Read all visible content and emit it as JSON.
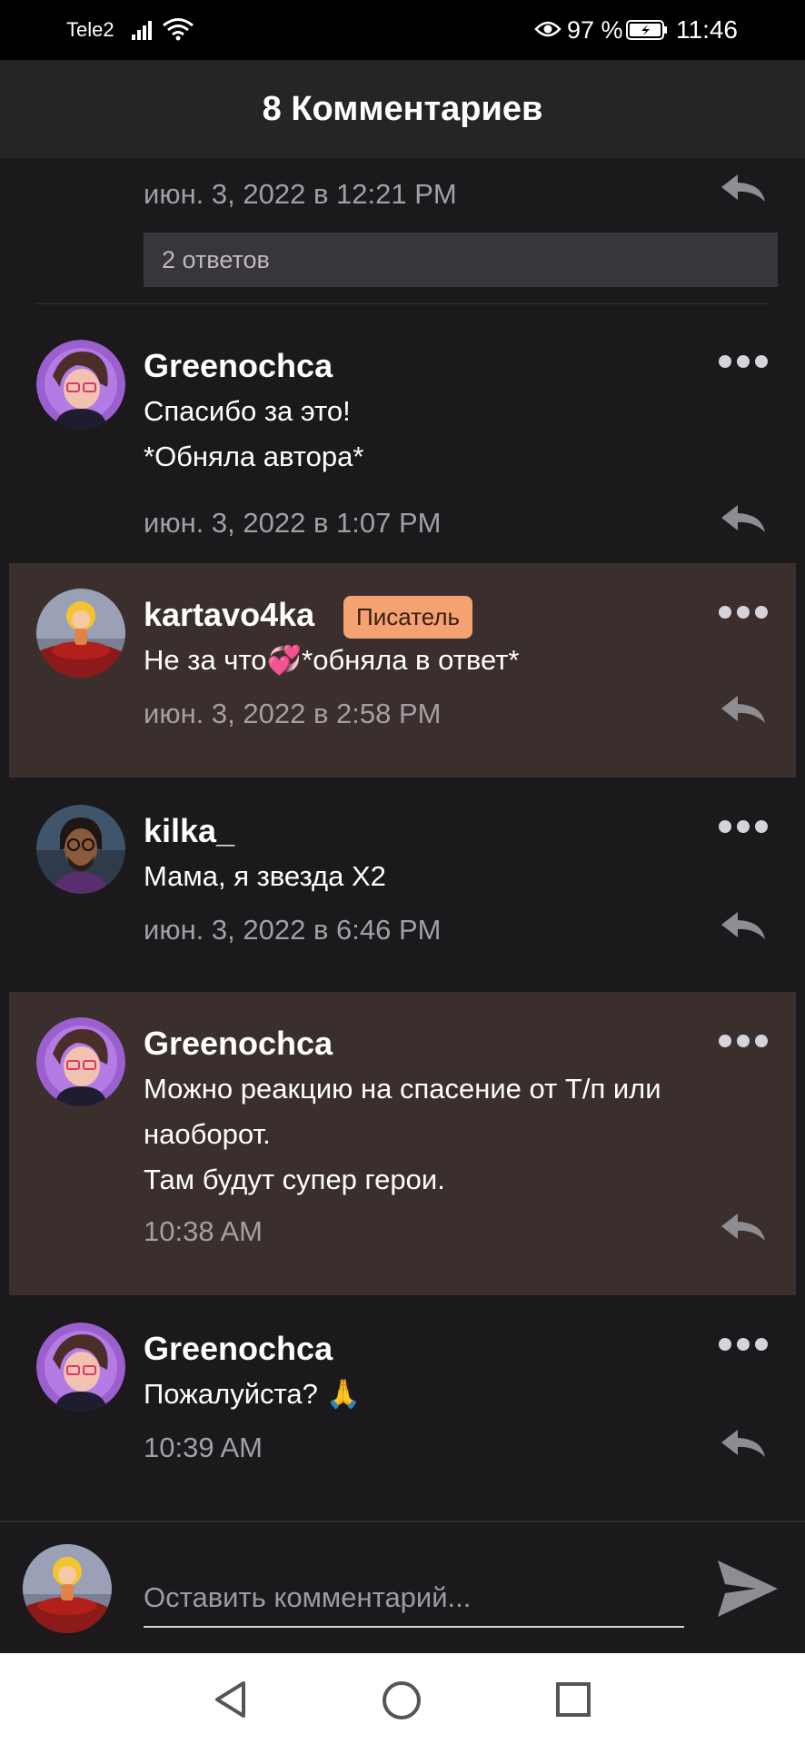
{
  "status_bar": {
    "carrier": "Tele2",
    "battery": "97 %",
    "time": "11:46"
  },
  "header": {
    "title": "8 Комментариев"
  },
  "top_partial": {
    "date": "июн. 3, 2022 в 12:21 PM",
    "replies_label": "2 ответов"
  },
  "comments": [
    {
      "author": "Greenochca",
      "badge": "",
      "text_lines": [
        "Спасибо за это!",
        "*Обняла автора*"
      ],
      "date": "июн. 3, 2022 в 1:07 PM",
      "highlight": false,
      "avatar": "purple"
    },
    {
      "author": "kartavo4ka",
      "badge": "Писатель",
      "text_lines": [
        "Не за что💞*обняла в ответ*"
      ],
      "date": "июн. 3, 2022 в 2:58 PM",
      "highlight": true,
      "avatar": "blond"
    },
    {
      "author": "kilka_",
      "badge": "",
      "text_lines": [
        "Мама, я звезда Х2"
      ],
      "date": "июн. 3, 2022 в 6:46 PM",
      "highlight": false,
      "avatar": "dark"
    },
    {
      "author": "Greenochca",
      "badge": "",
      "text_lines": [
        "Можно реакцию на спасение от Т/п или",
        "наоборот.",
        "Там будут супер герои."
      ],
      "date": "10:38 AM",
      "highlight": true,
      "avatar": "purple"
    },
    {
      "author": "Greenochca",
      "badge": "",
      "text_lines": [
        "Пожалуйста? 🙏"
      ],
      "date": "10:39 AM",
      "highlight": false,
      "avatar": "purple"
    }
  ],
  "comment_input": {
    "placeholder": "Оставить комментарий..."
  },
  "colors": {
    "background": "#1b191c",
    "header": "#262427",
    "highlight": "#3a2f2d",
    "badge": "#f4a272"
  }
}
